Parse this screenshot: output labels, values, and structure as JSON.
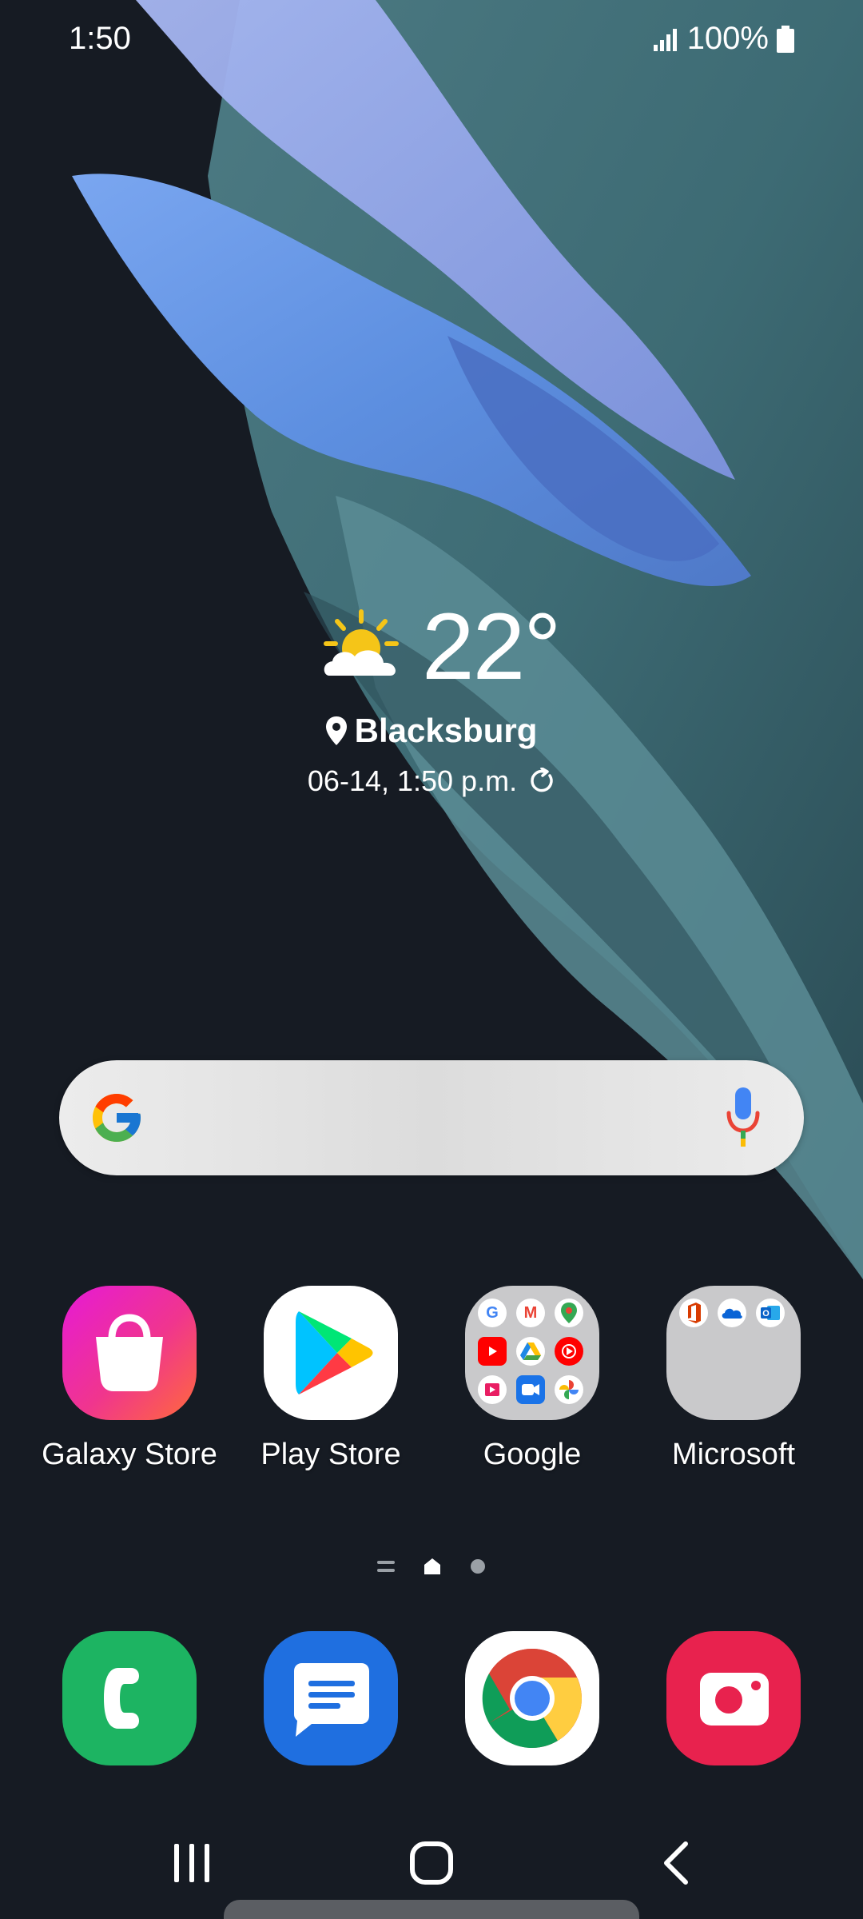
{
  "status_bar": {
    "time": "1:50",
    "battery": "100%"
  },
  "weather": {
    "temperature": "22°",
    "location": "Blacksburg",
    "updated": "06-14, 1:50 p.m.",
    "icon": "partly-sunny-icon"
  },
  "search": {
    "logo": "google-g-icon",
    "mic": "microphone-icon"
  },
  "apps": [
    {
      "label": "Galaxy Store",
      "icon": "shopping-bag-icon"
    },
    {
      "label": "Play Store",
      "icon": "play-triangle-icon"
    },
    {
      "label": "Google",
      "icon": "folder-icon"
    },
    {
      "label": "Microsoft",
      "icon": "folder-icon"
    }
  ],
  "page_indicator": {
    "pages": [
      "menu",
      "home",
      "page"
    ],
    "current": "home"
  },
  "dock": [
    {
      "icon": "phone-icon",
      "color": "#1db462"
    },
    {
      "icon": "messages-icon",
      "color": "#1f6fe0"
    },
    {
      "icon": "chrome-icon",
      "color": "#ffffff"
    },
    {
      "icon": "camera-icon",
      "color": "#e8224e"
    }
  ],
  "nav": {
    "recents": "recents-icon",
    "home": "home-icon",
    "back": "back-icon"
  },
  "colors": {
    "background": "#161b23",
    "galaxy_store_start": "#e61ad6",
    "galaxy_store_end": "#ff6a3a",
    "folder_bg": "#c9c9cb"
  }
}
